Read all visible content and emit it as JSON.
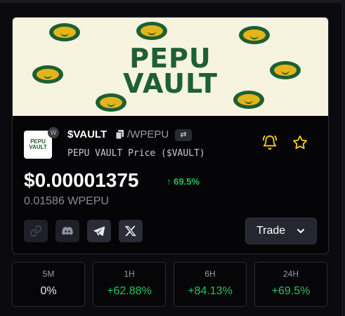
{
  "banner": {
    "line1": "PEPU",
    "line2": "VAULT"
  },
  "token": {
    "logo_text": "PEPU VAULT",
    "chain_badge": "W",
    "symbol": "$VAULT",
    "pair": "/WPEPU",
    "full_name": "PEPU VAULT Price ($VAULT)",
    "price": "$0.00001375",
    "change": "69.5%",
    "price_in_quote": "0.01586 WPEPU"
  },
  "actions": {
    "trade_label": "Trade"
  },
  "stats": [
    {
      "label": "5M",
      "value": "0%",
      "color": "#e8e8ee"
    },
    {
      "label": "1H",
      "value": "+62.88%",
      "color": "#22c55e"
    },
    {
      "label": "6H",
      "value": "+84.13%",
      "color": "#22c55e"
    },
    {
      "label": "24H",
      "value": "+69.5%",
      "color": "#22c55e"
    }
  ],
  "colors": {
    "accent_green": "#22c55e",
    "alert_yellow": "#facc15",
    "banner_green": "#1e5f35",
    "coin_gold": "#e4b51a"
  },
  "icons": [
    "copy-icon",
    "swap-icon",
    "bell-icon",
    "star-icon",
    "link-icon",
    "discord-icon",
    "telegram-icon",
    "x-icon",
    "chevron-down-icon"
  ]
}
